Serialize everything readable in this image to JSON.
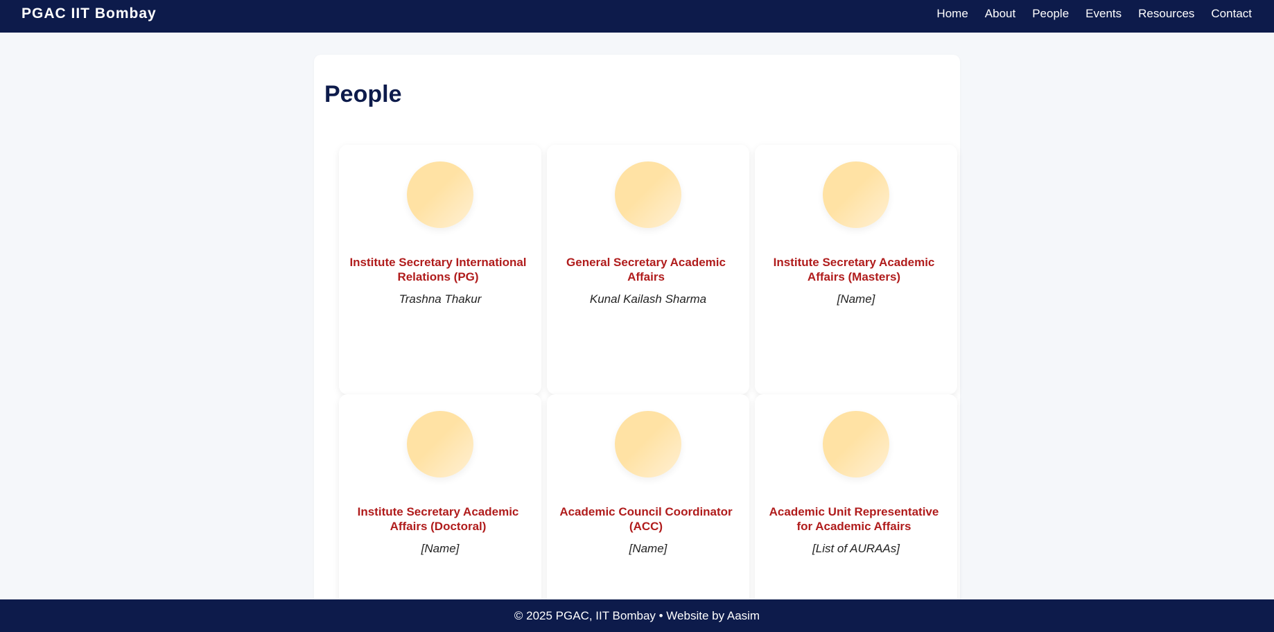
{
  "header": {
    "brand": "PGAC IIT Bombay",
    "nav": [
      "Home",
      "About",
      "People",
      "Events",
      "Resources",
      "Contact"
    ]
  },
  "main": {
    "title": "People",
    "people": [
      {
        "role": "Institute Secretary International Relations (PG)",
        "name": "Trashna Thakur"
      },
      {
        "role": "General Secretary Academic Affairs",
        "name": "Kunal Kailash Sharma"
      },
      {
        "role": "Institute Secretary Academic Affairs (Masters)",
        "name": "[Name]"
      },
      {
        "role": "Institute Secretary Academic Affairs (Doctoral)",
        "name": "[Name]"
      },
      {
        "role": "Academic Council Coordinator (ACC)",
        "name": "[Name]"
      },
      {
        "role": "Academic Unit Representative for Academic Affairs",
        "name": "[List of AURAAs]"
      }
    ]
  },
  "footer": {
    "text": "© 2025 PGAC, IIT Bombay • Website by Aasim"
  },
  "colors": {
    "navy": "#0d1b4b",
    "role_red": "#b01c1c",
    "avatar": "#ffe2a4"
  }
}
